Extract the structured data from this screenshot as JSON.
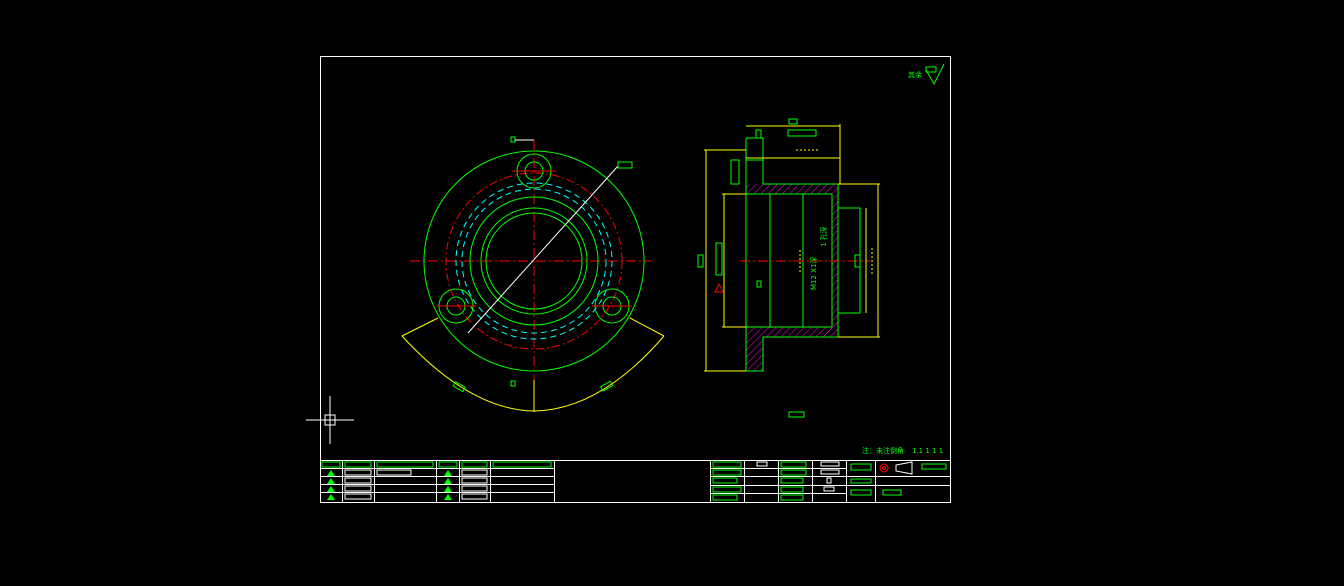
{
  "drawing": {
    "roughness_note_label": "其余",
    "bottom_note_prefix": "注：",
    "bottom_note_text": "未注倒角",
    "bottom_note_marks": "1.1 1 1 1",
    "section_text_left": "M12 X1深",
    "section_text_right": "1 孔深",
    "colors": {
      "background": "#000000",
      "frame": "#ffffff",
      "outline": "#00ff00",
      "centerline": "#ff0000",
      "hidden": "#00ffff",
      "dimension": "#ffff00",
      "hatch": "#ff00ff"
    }
  }
}
